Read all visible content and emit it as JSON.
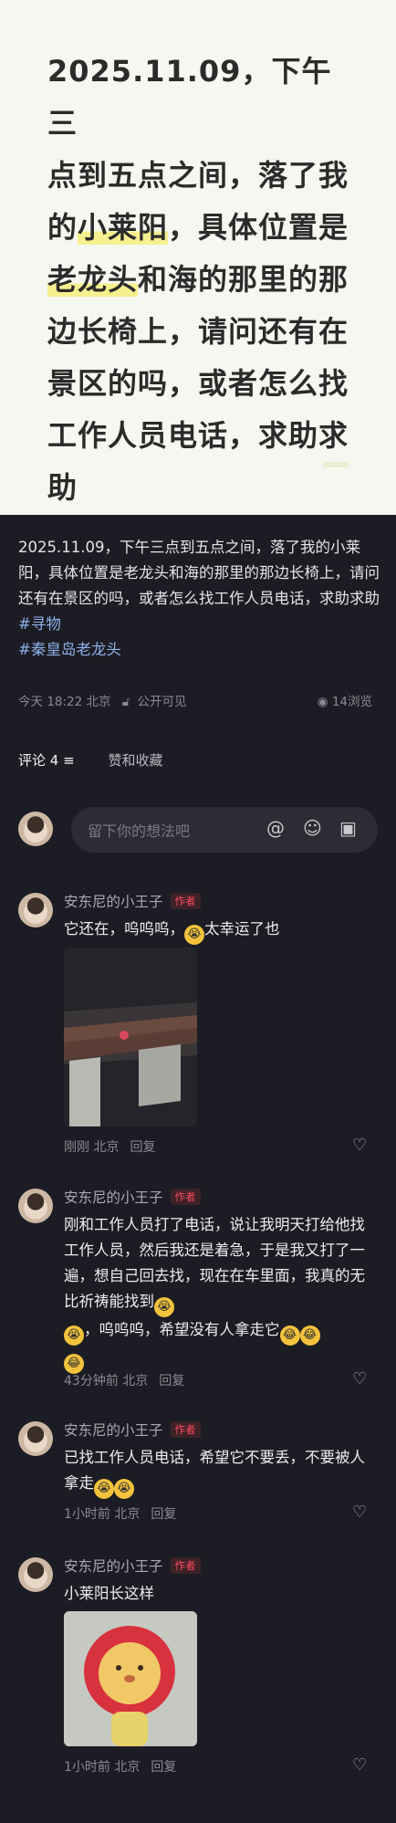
{
  "hero": {
    "line1": "2025.11.09，下午三",
    "line2": "点到五点之间，落了我",
    "line3_pre": "的",
    "line3_hl": "小莱阳",
    "line3_post": "，具体位置是",
    "line4_hl": "老龙头",
    "line4_post": "和海的那里的那",
    "line5": "边长椅上，请问还有在",
    "line6": "景区的吗，或者怎么找",
    "line7": "工作人员电话，求助求",
    "line8": "助"
  },
  "post": {
    "text": "2025.11.09，下午三点到五点之间，落了我的小莱阳，具体位置是老龙头和海的那里的那边长椅上，请问还有在景区的吗，或者怎么找工作人员电话，求助求助",
    "tags": [
      "#寻物",
      "#秦皇岛老龙头"
    ],
    "time": "今天 18:22 北京",
    "visibility": "公开可见",
    "views": "14浏览"
  },
  "tabs": {
    "comments": "评论 4",
    "likes": "赞和收藏"
  },
  "comment_input": {
    "placeholder": "留下你的想法吧"
  },
  "author_badge": "作者",
  "reply_label": "回复",
  "comments": [
    {
      "name": "安东尼的小王子",
      "text_a": "它还在，呜呜呜，",
      "text_b": "太幸运了也",
      "meta": "刚刚 北京"
    },
    {
      "name": "安东尼的小王子",
      "text": "刚和工作人员打了电话，说让我明天打给他找工作人员，然后我还是着急，于是我又打了一遍，想自己回去找，现在在车里面，我真的无比祈祷能找到",
      "text_tail": "，呜呜呜，希望没有人拿走它",
      "meta": "43分钟前 北京"
    },
    {
      "name": "安东尼的小王子",
      "text": "已找工作人员电话，希望它不要丢，不要被人拿走",
      "meta": "1小时前 北京"
    },
    {
      "name": "安东尼的小王子",
      "text": "小莱阳长这样",
      "meta": "1小时前 北京"
    }
  ]
}
